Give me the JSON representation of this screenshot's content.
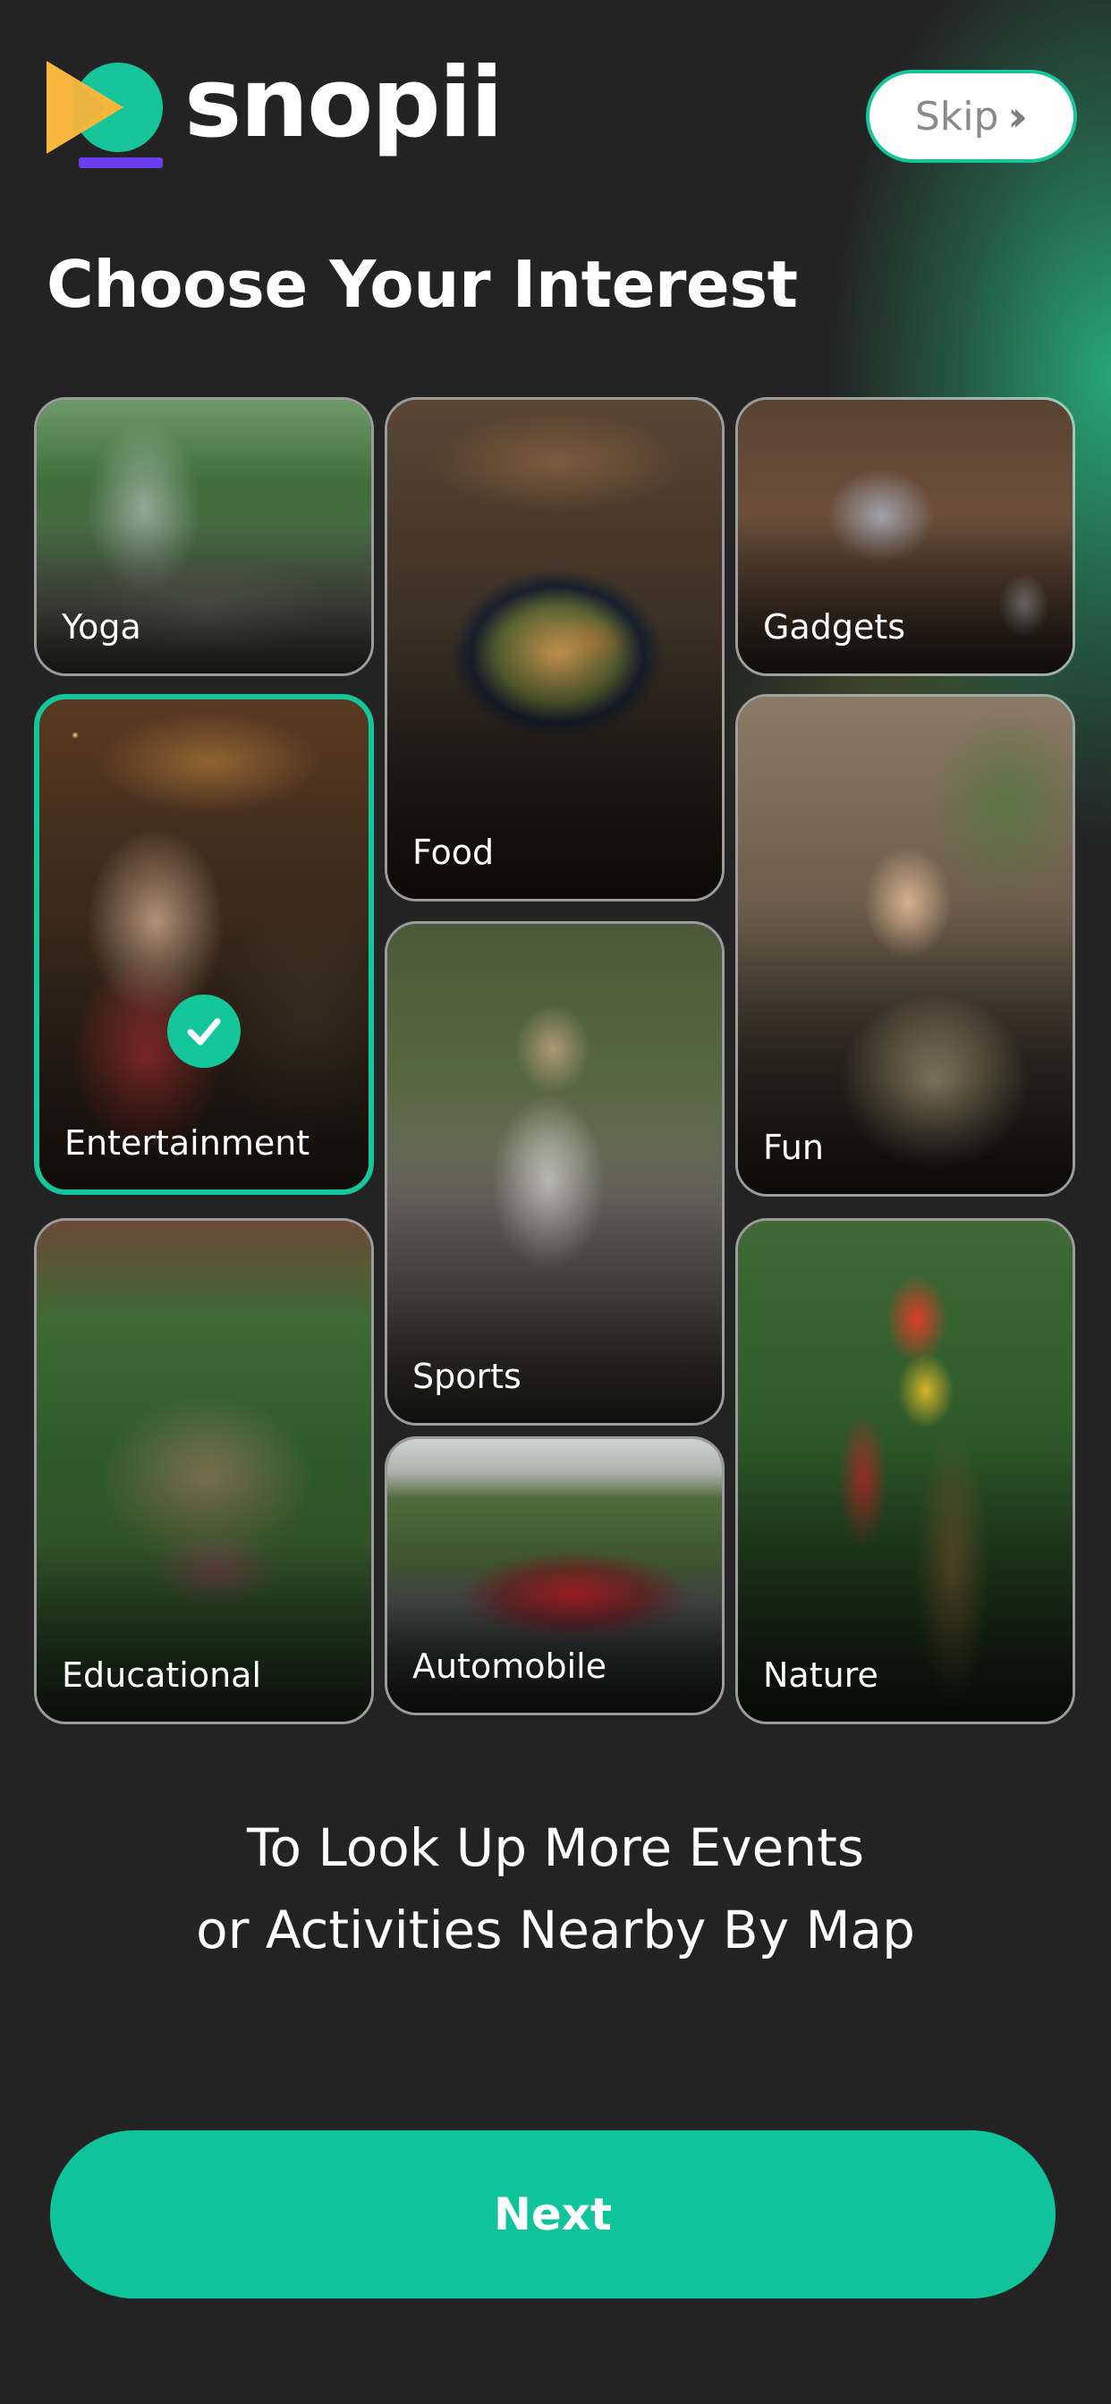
{
  "header": {
    "brand_name": "snopii",
    "logo_icon": "play-logo-icon",
    "skip_label": "Skip",
    "skip_icon": "double-chevron-right-icon"
  },
  "page_title": "Choose Your Interest",
  "interests": [
    {
      "label": "Yoga",
      "selected": false
    },
    {
      "label": "Food",
      "selected": false
    },
    {
      "label": "Gadgets",
      "selected": false
    },
    {
      "label": "Entertainment",
      "selected": true
    },
    {
      "label": "Fun",
      "selected": false
    },
    {
      "label": "Sports",
      "selected": false
    },
    {
      "label": "Educational",
      "selected": false
    },
    {
      "label": "Automobile",
      "selected": false
    },
    {
      "label": "Nature",
      "selected": false
    }
  ],
  "footer": {
    "line1": "To Look Up More Events",
    "line2": "or Activities Nearby By Map",
    "next_label": "Next"
  },
  "colors": {
    "accent": "#13c79a",
    "background": "#232323",
    "logo_yellow": "#f6b73c",
    "logo_green": "#17c59a",
    "logo_purple": "#6a3df0"
  }
}
